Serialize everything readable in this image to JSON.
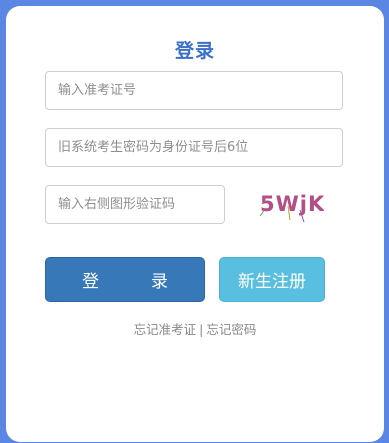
{
  "title": "登录",
  "fields": {
    "ticket_placeholder": "输入准考证号",
    "password_placeholder": "旧系统考生密码为身份证号后6位",
    "captcha_placeholder": "输入右侧图形验证码"
  },
  "captcha": {
    "text": "5WjK"
  },
  "buttons": {
    "login_char1": "登",
    "login_char2": "录",
    "register": "新生注册"
  },
  "links": {
    "forgot_ticket": "忘记准考证",
    "separator": "|",
    "forgot_password": "忘记密码"
  },
  "colors": {
    "background": "#5b86e3",
    "title": "#3a70c9",
    "login_button": "#3678b8",
    "register_button": "#59bfe0",
    "captcha_text": "#b24f86"
  }
}
